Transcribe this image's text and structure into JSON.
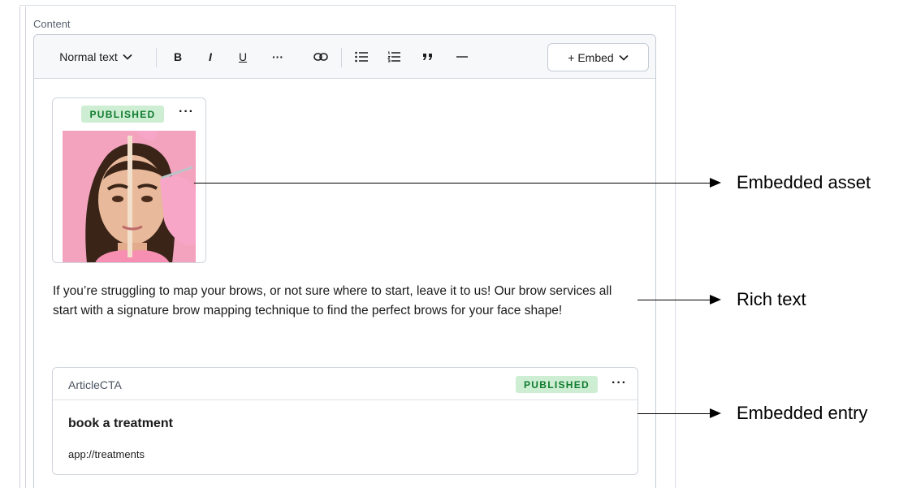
{
  "field": {
    "label": "Content"
  },
  "toolbar": {
    "format_label": "Normal text",
    "bold_label": "B",
    "italic_label": "I",
    "underline_label": "U",
    "more_label": "···",
    "embed_label": "+ Embed",
    "icons": [
      "chevron-down-icon",
      "link-icon",
      "bulleted-list-icon",
      "numbered-list-icon",
      "quote-icon",
      "horizontal-rule-icon"
    ]
  },
  "asset": {
    "status": "PUBLISHED",
    "menu_label": "···",
    "image_desc": "woman-brow-mapping-photo"
  },
  "rich_text": "If you’re struggling to map your brows, or not sure where to start, leave it to us! Our brow services all start with a signature brow mapping technique to find the perfect brows for your face shape!",
  "entry": {
    "type": "ArticleCTA",
    "status": "PUBLISHED",
    "menu_label": "···",
    "title": "book a treatment",
    "url": "app://treatments"
  },
  "annotations": {
    "asset": "Embedded asset",
    "rich_text": "Rich text",
    "entry": "Embedded entry"
  },
  "colors": {
    "badge_bg": "#cdeed3",
    "badge_text": "#0f7a2e",
    "photo_bg": "#f4a3bf",
    "border": "#c5ccd6"
  }
}
